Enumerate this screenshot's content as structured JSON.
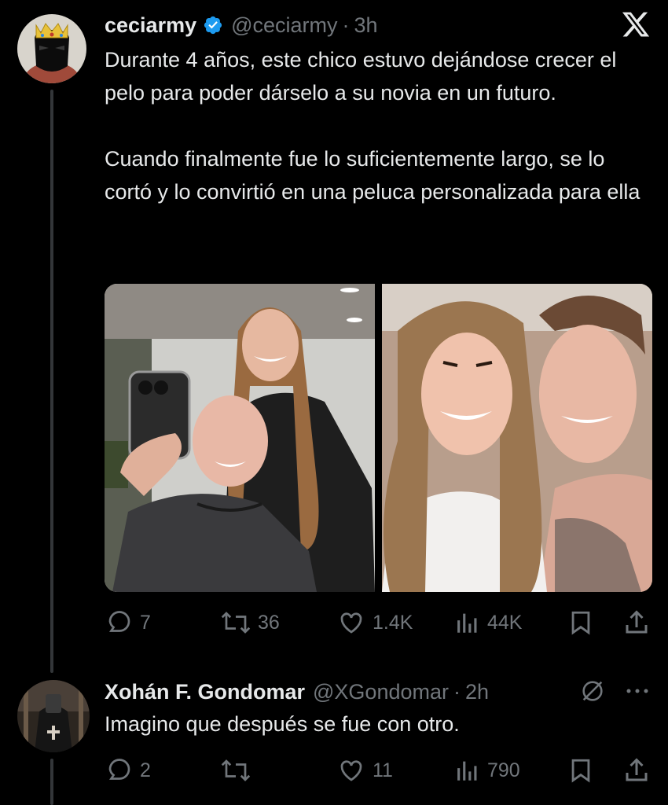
{
  "tweet": {
    "display_name": "ceciarmy",
    "handle": "@ceciarmy",
    "time": "3h",
    "text_p1": "Durante 4 años, este chico estuvo dejándose crecer el pelo para poder dárselo a su novia en un futuro.",
    "text_p2": "Cuando finalmente fue lo suficientemente largo, se lo cortó y lo convirtió en una peluca personalizada para ella",
    "replies": "7",
    "retweets": "36",
    "likes": "1.4K",
    "views": "44K"
  },
  "reply": {
    "display_name": "Xohán F. Gondomar",
    "handle": "@XGondomar",
    "time": "2h",
    "text": "Imagino que después se fue con otro.",
    "replies": "2",
    "retweets": "",
    "likes": "11",
    "views": "790"
  },
  "separator": "·",
  "colors": {
    "background": "#000000",
    "text": "#e7e9ea",
    "secondary": "#71767b",
    "verified": "#1d9bf0"
  },
  "icons": [
    "x-logo-icon",
    "verified-badge-icon",
    "reply-icon",
    "retweet-icon",
    "like-icon",
    "views-icon",
    "bookmark-icon",
    "share-icon",
    "grok-icon",
    "more-icon"
  ]
}
